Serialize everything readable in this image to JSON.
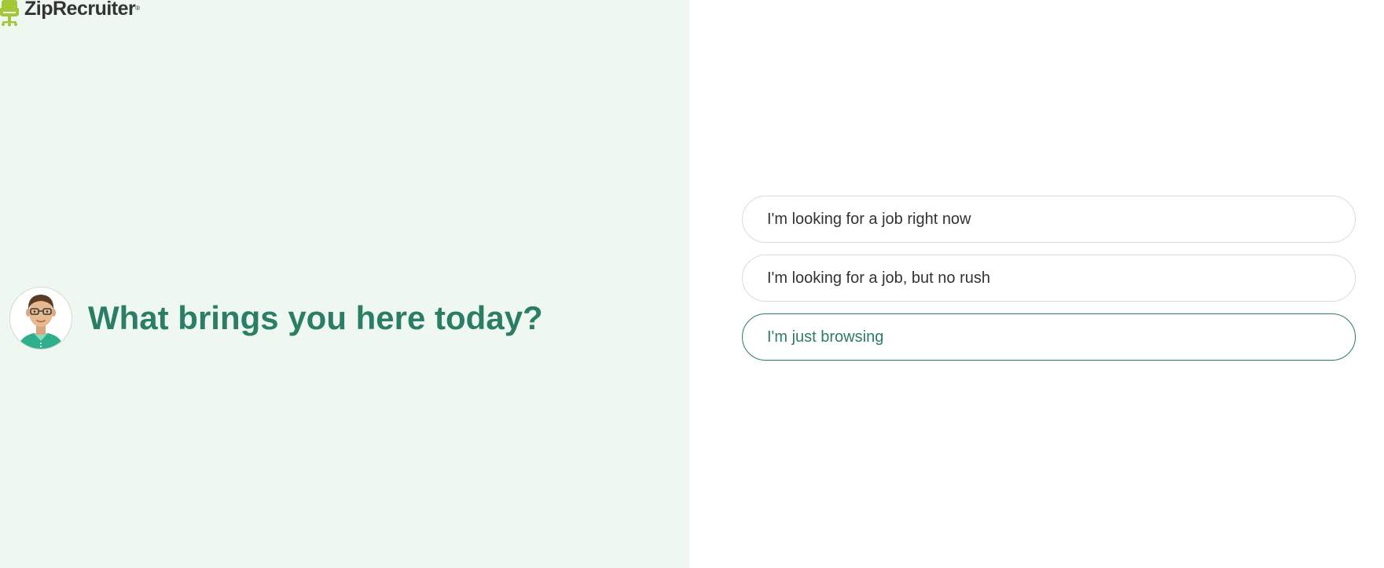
{
  "brand": {
    "name": "ZipRecruiter",
    "registered": "®",
    "colors": {
      "logo_green": "#a4c639",
      "heading_teal": "#2b7d65",
      "left_background": "#eef8f0"
    }
  },
  "prompt": {
    "avatar_icon": "person-avatar-icon",
    "question": "What brings you here today?"
  },
  "options": [
    {
      "label": "I'm looking for a job right now",
      "selected": false
    },
    {
      "label": "I'm looking for a job, but no rush",
      "selected": false
    },
    {
      "label": "I'm just browsing",
      "selected": true
    }
  ]
}
